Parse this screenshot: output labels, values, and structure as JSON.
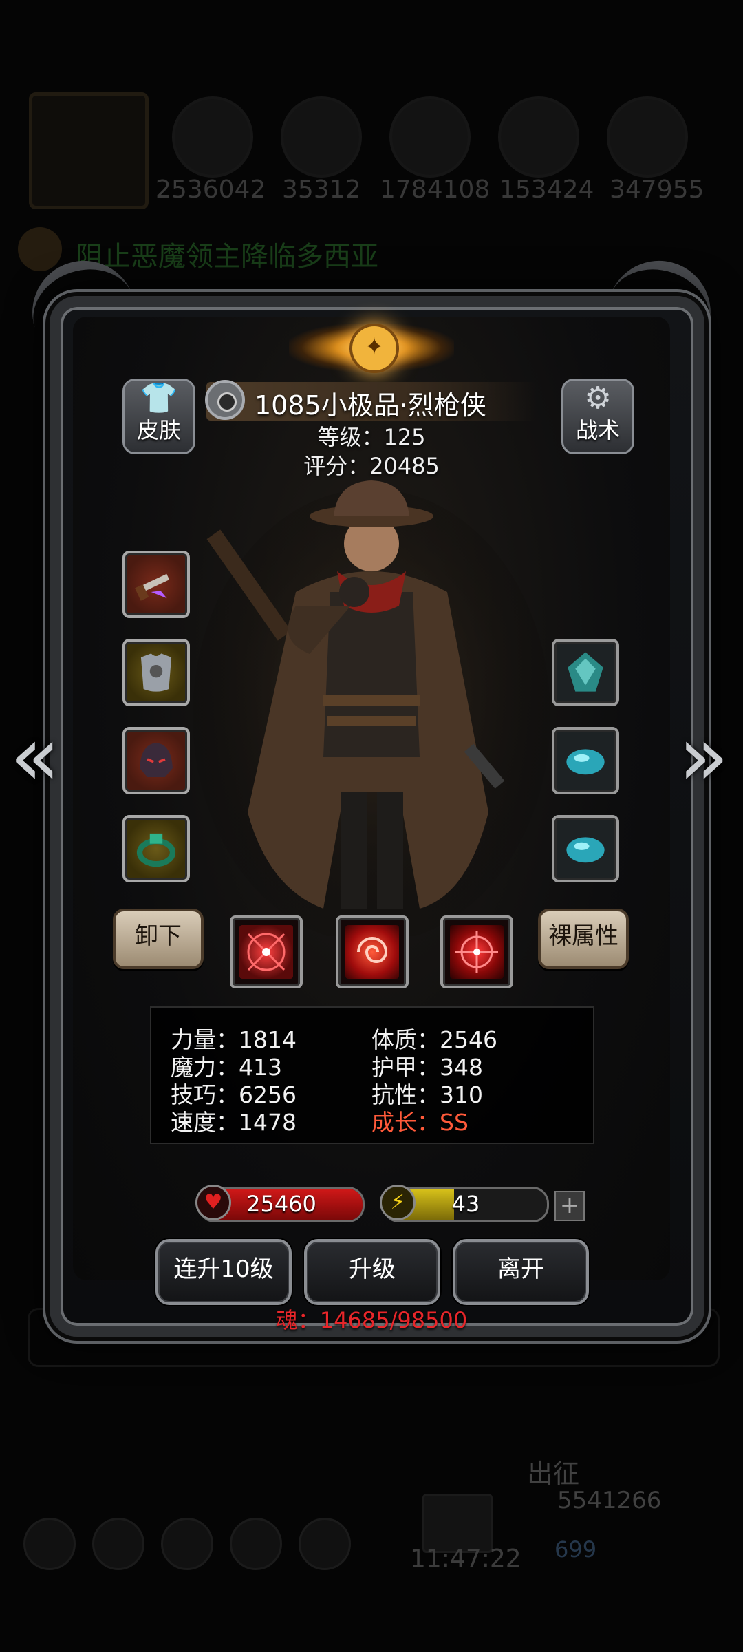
{
  "background": {
    "resources": [
      "2536042",
      "35312",
      "1784108",
      "153424",
      "347955"
    ],
    "quest_text": "阻止恶魔领主降临多西亚",
    "march_label": "出征",
    "gold_value": "5541266",
    "gem_value": "699",
    "clock": "11:47:22"
  },
  "header": {
    "skin_label": "皮肤",
    "tactics_label": "战术",
    "hero_name": "1085小极品·烈枪侠",
    "level_text": "等级：125",
    "score_text": "评分：20485"
  },
  "equipment": {
    "left_slots": [
      "flintlock-pistol-icon",
      "chest-armor-icon",
      "helmet-icon",
      "ring-icon"
    ],
    "right_slots": [
      "crystal-gem-icon",
      "cyan-gem-icon",
      "cyan-gem-icon"
    ]
  },
  "actions": {
    "unequip_label": "卸下",
    "bare_attr_label": "裸属性"
  },
  "stats": {
    "strength": "力量：1814",
    "magic": "魔力：413",
    "skill": "技巧：6256",
    "speed": "速度：1478",
    "constitution": "体质：2546",
    "armor": "护甲：348",
    "resistance": "抗性：310",
    "growth": "成长：SS"
  },
  "bars": {
    "hp_value": "25460",
    "hp_fill": 1.0,
    "energy_value": "43",
    "energy_fill": 0.43,
    "hp_color": "#d01818",
    "energy_color": "#d8c21a"
  },
  "buttons": {
    "level_up_10": "连升10级",
    "level_up": "升级",
    "leave": "离开"
  },
  "soul_text": "魂：14685/98500",
  "colors": {
    "accent_gold": "#f1b43c",
    "growth_red": "#ff5a3a",
    "soul_red": "#e8262a"
  }
}
